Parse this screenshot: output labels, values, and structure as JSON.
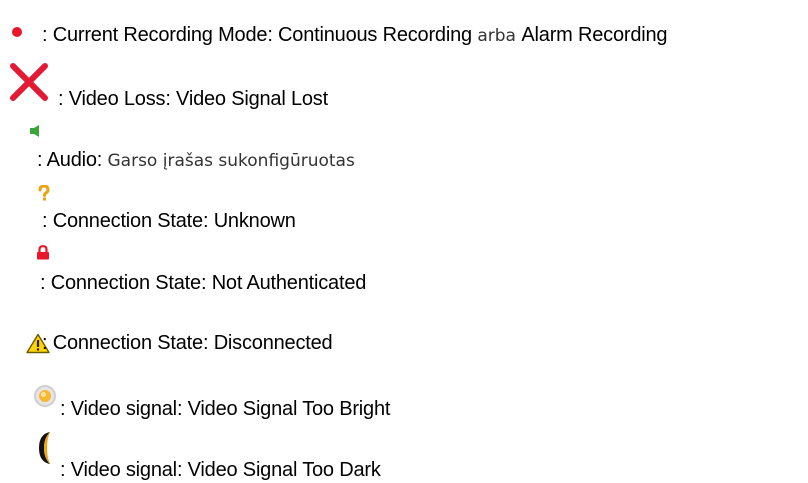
{
  "colors": {
    "recording_dot": "#e8172a",
    "video_loss_cross": "#e21a33",
    "audio_speaker": "#3aa63a",
    "unknown_question": "#e7a50f",
    "lock": "#e8172a",
    "warning_fill": "#ffd400",
    "sun_center": "#f7b733",
    "moon": "#f2a20c",
    "text": "#000000",
    "plain_text": "#333333"
  },
  "entries": [
    {
      "icon": "recording-dot-icon",
      "sep": ": ",
      "label": "Current Recording Mode",
      "colon": ": ",
      "value": "Continuous Recording",
      "joiner": " arba ",
      "value2": "Alarm Recording"
    },
    {
      "icon": "video-loss-cross-icon",
      "sep": " : ",
      "label": "Video Loss",
      "colon": ": ",
      "value": "Video Signal Lost"
    },
    {
      "icon": "speaker-icon",
      "sep": ": ",
      "label": "Audio",
      "colon": ": ",
      "value": "Garso įrašas sukonfigūruotas"
    },
    {
      "icon": "question-mark-icon",
      "sep": ": ",
      "label": "Connection State",
      "colon": ": ",
      "value": "Unknown"
    },
    {
      "icon": "lock-icon",
      "sep": ": ",
      "label": "Connection State",
      "colon": ": ",
      "value": "Not Authenticated"
    },
    {
      "icon": "warning-triangle-icon",
      "sep": ": ",
      "label": "Connection State",
      "colon": ": ",
      "value": "Disconnected"
    },
    {
      "icon": "sun-icon",
      "sep": ": ",
      "label": "Video signal",
      "colon": ": ",
      "value": "Video Signal Too Bright"
    },
    {
      "icon": "moon-icon",
      "sep": ": ",
      "label": "Video signal",
      "colon": ": ",
      "value": "Video Signal Too Dark"
    }
  ]
}
